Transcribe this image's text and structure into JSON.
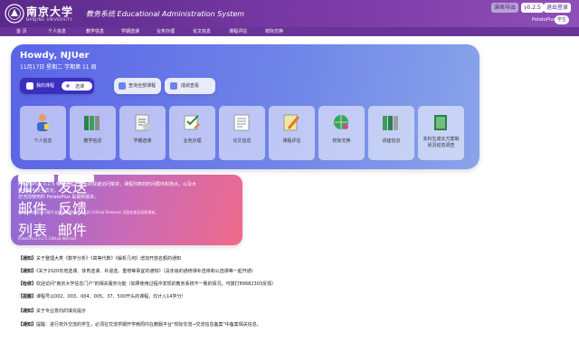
{
  "header": {
    "brand": "南京大学",
    "brand_sub": "NANJING UNIVERSITY",
    "system_title": "教务系统 Educational Administration System",
    "classic_mode": "课表导出",
    "version": "v0.2.5",
    "logout": "退出登录",
    "plugin_name": "PotatoPlus",
    "plugin_badge": "学生"
  },
  "nav": [
    "首 页",
    "个人信息",
    "教学信息",
    "学期选课",
    "业务办理",
    "论文信息",
    "课程评估",
    "校际交换"
  ],
  "hero": {
    "greeting": "Howdy, NJUer",
    "date": "11月17日 星期二  学期第 11 周",
    "my_courses": "我的课程",
    "add_button": "选课",
    "view_all": "查询全部课程",
    "grades": "成绩查看"
  },
  "tiles": [
    {
      "label": "个人信息",
      "icon": "person-icon"
    },
    {
      "label": "教学信息",
      "icon": "books-icon"
    },
    {
      "label": "学期选课",
      "icon": "paper-icon"
    },
    {
      "label": "业务办理",
      "icon": "checklist-icon"
    },
    {
      "label": "论文信息",
      "icon": "document-icon"
    },
    {
      "label": "课程评估",
      "icon": "pencil-icon"
    },
    {
      "label": "校际交换",
      "icon": "globe-icon"
    },
    {
      "label": "讲座信息",
      "icon": "books-icon"
    },
    {
      "label": "本科生成长方案制",
      "label2": "状况动态调查",
      "icon": "book-icon"
    }
  ],
  "promo": {
    "line1": "PotatoPlus 0.2.5 带来了位于首页的快速访问菜单，课程列表的时间循环和地点，以及大",
    "line2": "量有用与交互优化。",
    "line3": "您当前使用的 PotatoPlus 是最新版本。",
    "line4": "您的安装的版本可能不支持自动更新，请访问 GitHub Releases 页面检查及获取更新。",
    "btn_join": "加入邮件列表",
    "btn_feedback": "发送反馈邮件",
    "footer": "PotatoPlus 0.2.5    GitHub    稀Lnnos"
  },
  "news": [
    {
      "tag": "【通知】",
      "text": "关于整理大类《数学分析》《高等代数》《解析几何》增加开放名额的通知"
    },
    {
      "tag": "【通知】",
      "text": "《关于2020年增选课、体育选课、补退选、重修等事宜的通知》（具年级的通修课补选将和公选课等一起开通）"
    },
    {
      "tag": "【检修】",
      "text": "欢迎访问\"南京大学信息门户\"的相关服务功能（如果使用过程中发现的教务系统不一致的情况，可拨打89682303反馈）"
    },
    {
      "tag": "【提醒】",
      "text": "课程号以002、003、004、005、37、500开头的课程，均计入14学分！"
    },
    {
      "tag": "【通知】",
      "text": "关于专业意向的填充提示"
    },
    {
      "tag": "【通知】",
      "text": "提醒：进行校外交流的学生，必须在交流学期开学两周内在教服平台\"校际交流→交流信息备案\"中备案相关信息。"
    }
  ],
  "colors": {
    "header": "#6a3397",
    "hero_start": "#5a64e6",
    "primary_button": "#3a2fbf",
    "promo_end": "#f06a8a"
  }
}
